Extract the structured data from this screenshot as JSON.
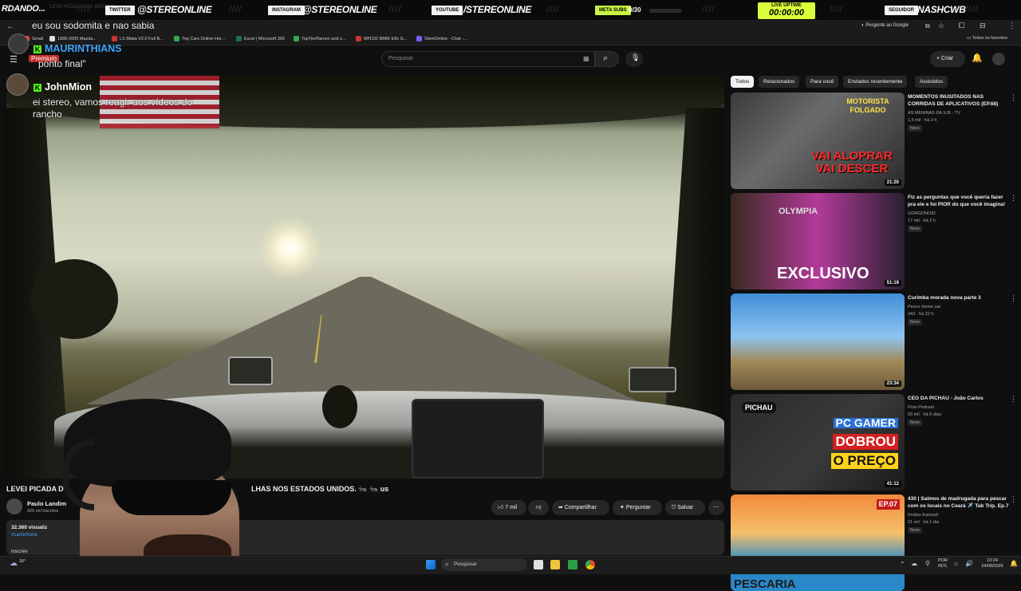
{
  "overlay": {
    "left_text": "RDANDO...",
    "left_faint": "LEVEI PICADA DAS MENINAS",
    "twitter_tag": "TWITTER",
    "twitter_handle": "@STEREONLINE",
    "instagram_tag": "INSTAGRAM",
    "instagram_handle": "@STEREONLINE",
    "youtube_tag": "YOUTUBE",
    "youtube_handle": "/STEREONLINE",
    "meta_tag": "META SUBS",
    "meta_value": "0/30",
    "meta_progress": 0,
    "live_label": "LIVE UPTIME",
    "live_time": "00:00:00",
    "follower_tag": "SEGUIDOR",
    "follower_name": "NASHCWB",
    "accent": "#d9ff3a"
  },
  "browser": {
    "address_right": "Pergunte ao Google",
    "favorites": "Todos os favoritos",
    "bookmarks": [
      {
        "label": "Gmail",
        "color": "#ea4335"
      },
      {
        "label": "1989-2005 Mazda...",
        "color": "#dddddd"
      },
      {
        "label": "LS Miata V2.0 Full B...",
        "color": "#c33"
      },
      {
        "label": "Top Cars Online Hor...",
        "color": "#34a853"
      },
      {
        "label": "Excel | Microsoft 365",
        "color": "#1e7145"
      },
      {
        "label": "TopTierRamen and s...",
        "color": "#34a853"
      },
      {
        "label": "MFD32 BMW E8x G...",
        "color": "#c33"
      },
      {
        "label": "StereOnline - Chat -...",
        "color": "#7b5cff"
      }
    ]
  },
  "youtube": {
    "search_placeholder": "Pesquisar",
    "create_label": "Criar",
    "chips": [
      "Todos",
      "Relacionados",
      "Para você",
      "Enviados recentemente",
      "Assistidos"
    ],
    "video_title_start": "LEVEI PICADA D",
    "video_title_end": "LHAS NOS ESTADOS UNIDOS. 🐜 🐜 us",
    "channel_name": "Paulo Landim",
    "channel_subs": "925 mil inscritos",
    "views": "32.360 visualiz",
    "hashtag": "#caminhone",
    "desc_fragment": "inscrev",
    "likes": "7 mil",
    "share_label": "Compartilhar",
    "ask_label": "Perguntar",
    "save_label": "Salvar",
    "related": [
      {
        "title": "MOMENTOS INUSITADOS NAS CORRIDAS DE APLICATIVOS (EP.68)",
        "channel": "AS MENINAS DA XJ6 - TV",
        "meta": "1,5 mil · há 2 h",
        "badge": "Novo",
        "duration": "21:20",
        "thumb_text_top": "MOTORISTA FOLGADO",
        "thumb_text_bottom": "VAI ALOPRAR VAI DESCER"
      },
      {
        "title": "Fiz as perguntas que você queria fazer pra ele e foi PIOR do que você imagina!",
        "channel": "GORGONOID",
        "meta": "17 mil · há 2 h",
        "badge": "Novo",
        "duration": "51:19",
        "thumb_text_top": "OLYMPIA",
        "thumb_text_bottom": "EXCLUSIVO"
      },
      {
        "title": "Curimba morada nova parte 3",
        "channel": "Pesco memo uai",
        "meta": "243 · há 22 h",
        "badge": "Novo",
        "duration": "23:34"
      },
      {
        "title": "CEO DA PICHAU - João Carlos",
        "channel": "Flow Podcast",
        "meta": "93 mil · há 6 dias",
        "badge": "Novo",
        "duration": "41:12",
        "thumb_text_top": "PC GAMER",
        "thumb_text_mid": "DOBROU",
        "thumb_text_bottom": "O PREÇO",
        "thumb_brand": "PICHAU"
      },
      {
        "title": "430 | Saímos de madrugada para pescar com os locais no Ceará ✈️ Tab Trip. Ep.7",
        "channel": "Irmãos Katoosh",
        "meta": "21 mil · há 1 dia",
        "badge": "Novo",
        "thumb_text_top": "EP.07",
        "thumb_text_bottom": "PESCARIA"
      }
    ]
  },
  "chat": [
    {
      "user": "",
      "message": "eu sou sodomita e nao sabia"
    },
    {
      "user": "MAURINTHIANS",
      "role": "Premium",
      "message": "ponto final\""
    },
    {
      "user": "JohnMion",
      "message": "ei stereo, vamos reagir aos vídeos do rancho"
    }
  ],
  "taskbar": {
    "search_label": "Pesquisar",
    "lang_top": "POR",
    "lang_bottom": "INTL",
    "time": "13:24",
    "date": "24/08/2026",
    "weather_fragment": "16°"
  }
}
